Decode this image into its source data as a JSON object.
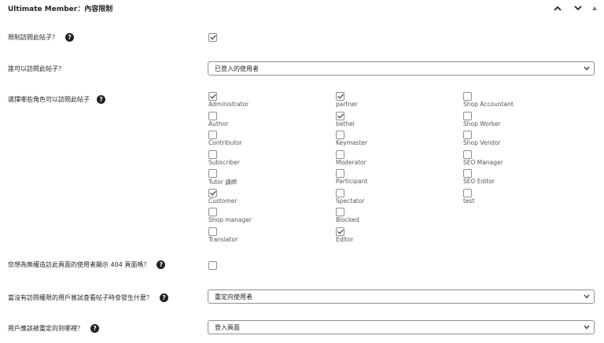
{
  "metabox": {
    "title": "Ultimate Member：內容限制",
    "controls": [
      {
        "icon": "chevron-up-icon"
      },
      {
        "icon": "chevron-down-icon"
      },
      {
        "icon": "triangle-up-icon"
      }
    ]
  },
  "fields": {
    "restrict": {
      "label": "限制訪問此帖子？",
      "checked": true
    },
    "who_can_access": {
      "label": "誰可以訪問此帖子？",
      "value": "已登入的使用者"
    },
    "roles_label": "選擇哪些角色可以訪問此帖子",
    "show_404": {
      "label": "您想為無權造訪此頁面的使用者顯示 404 頁面嗎？",
      "checked": false
    },
    "no_access_action": {
      "label": "當沒有訪問權限的用戶嘗試查看帖子時會發生什麼？",
      "value": "重定向使用者"
    },
    "redirect_where": {
      "label": "用戶應該被重定向到哪裡？",
      "value": "登入頁面"
    }
  },
  "roles": {
    "col1": [
      {
        "name": "Administrator",
        "checked": true
      },
      {
        "name": "Author",
        "checked": false
      },
      {
        "name": "Contributor",
        "checked": false
      },
      {
        "name": "Subscriber",
        "checked": false
      },
      {
        "name": "Tutor 講師",
        "checked": false
      },
      {
        "name": "Customer",
        "checked": true
      },
      {
        "name": "Shop manager",
        "checked": false
      },
      {
        "name": "Translator",
        "checked": false
      }
    ],
    "col2": [
      {
        "name": "partner",
        "checked": true
      },
      {
        "name": "bethel",
        "checked": true
      },
      {
        "name": "Keymaster",
        "checked": false
      },
      {
        "name": "Moderator",
        "checked": false
      },
      {
        "name": "Participant",
        "checked": false
      },
      {
        "name": "Spectator",
        "checked": false
      },
      {
        "name": "Blocked",
        "checked": false
      },
      {
        "name": "Editor",
        "checked": true
      }
    ],
    "col3": [
      {
        "name": "Shop Accountant",
        "checked": false
      },
      {
        "name": "Shop Worker",
        "checked": false
      },
      {
        "name": "Shop Vendor",
        "checked": false
      },
      {
        "name": "SEO Manager",
        "checked": false
      },
      {
        "name": "SEO Editor",
        "checked": false
      },
      {
        "name": "test",
        "checked": false
      }
    ]
  },
  "colors": {
    "text": "#1d2327",
    "muted": "#50575e",
    "border": "#8c8f94"
  }
}
